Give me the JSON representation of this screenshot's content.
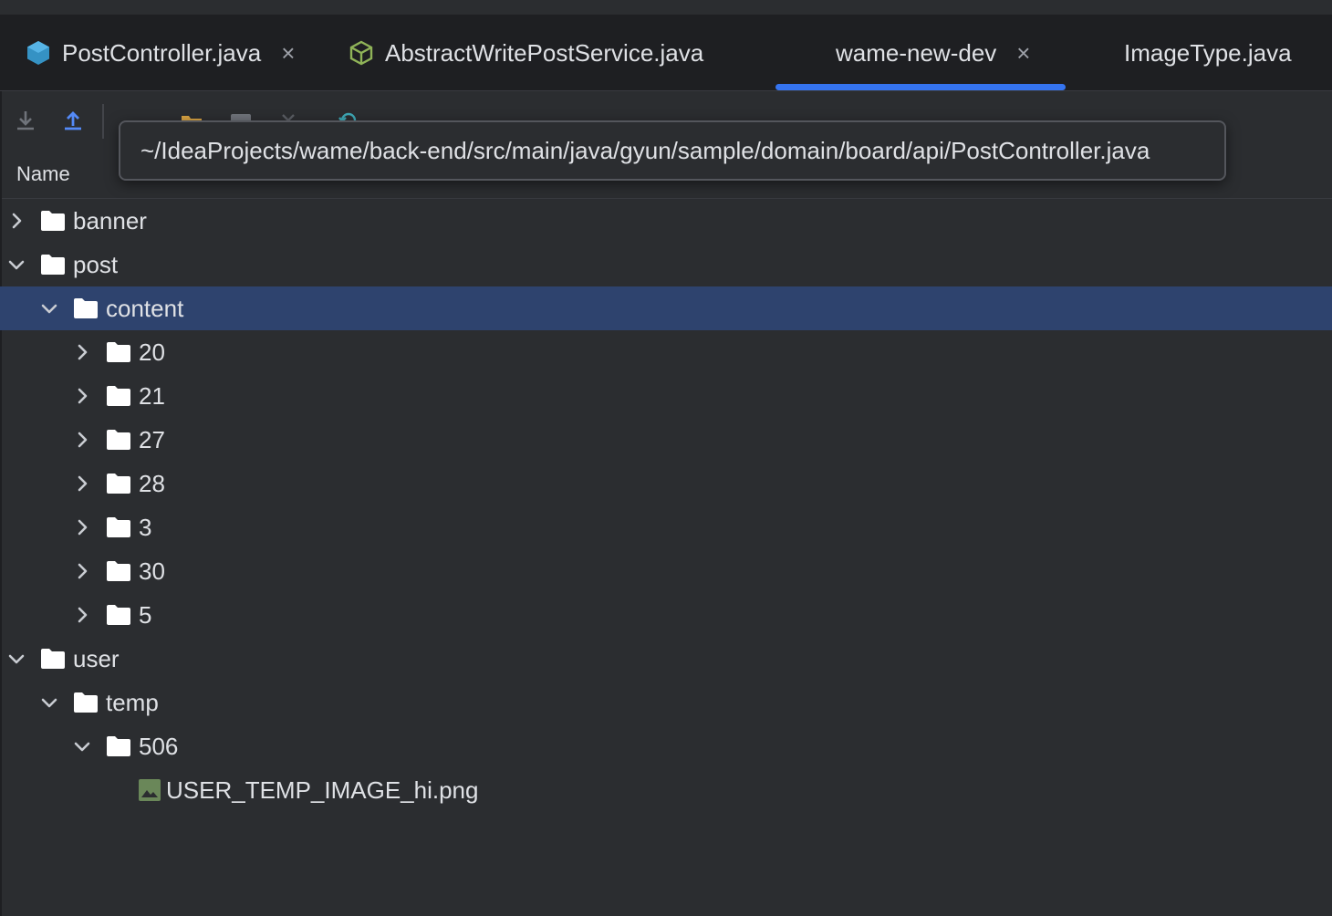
{
  "tabs": [
    {
      "label": "PostController.java",
      "close": "×",
      "icon": "java-class-icon",
      "color": "#3592c4"
    },
    {
      "label": "AbstractWritePostService.java",
      "icon": "abstract-class-icon",
      "color": "#8fb358"
    },
    {
      "label": "wame-new-dev",
      "close": "×",
      "active": true
    },
    {
      "label": "ImageType.java"
    }
  ],
  "toolbar": {
    "icons": [
      "download-icon",
      "upload-icon",
      "folder-icon",
      "window-icon",
      "close-icon",
      "refresh-icon"
    ]
  },
  "column_header": {
    "name": "Name"
  },
  "tooltip": {
    "path": "~/IdeaProjects/wame/back-end/src/main/java/gyun/sample/domain/board/api/PostController.java"
  },
  "tree": [
    {
      "label": "banner",
      "level": 0,
      "expanded": false,
      "type": "folder"
    },
    {
      "label": "post",
      "level": 0,
      "expanded": true,
      "type": "folder"
    },
    {
      "label": "content",
      "level": 1,
      "expanded": true,
      "type": "folder",
      "selected": true
    },
    {
      "label": "20",
      "level": 2,
      "expanded": false,
      "type": "folder"
    },
    {
      "label": "21",
      "level": 2,
      "expanded": false,
      "type": "folder"
    },
    {
      "label": "27",
      "level": 2,
      "expanded": false,
      "type": "folder"
    },
    {
      "label": "28",
      "level": 2,
      "expanded": false,
      "type": "folder"
    },
    {
      "label": "3",
      "level": 2,
      "expanded": false,
      "type": "folder"
    },
    {
      "label": "30",
      "level": 2,
      "expanded": false,
      "type": "folder"
    },
    {
      "label": "5",
      "level": 2,
      "expanded": false,
      "type": "folder"
    },
    {
      "label": "user",
      "level": 0,
      "expanded": true,
      "type": "folder"
    },
    {
      "label": "temp",
      "level": 1,
      "expanded": true,
      "type": "folder"
    },
    {
      "label": "506",
      "level": 2,
      "expanded": true,
      "type": "folder"
    },
    {
      "label": "USER_TEMP_IMAGE_hi.png",
      "level": 3,
      "type": "image"
    }
  ],
  "colors": {
    "accent": "#3574f0",
    "selection": "#2e436e",
    "background": "#2b2d30",
    "tabbar": "#1e1f22",
    "image_icon": "#6a8759"
  }
}
